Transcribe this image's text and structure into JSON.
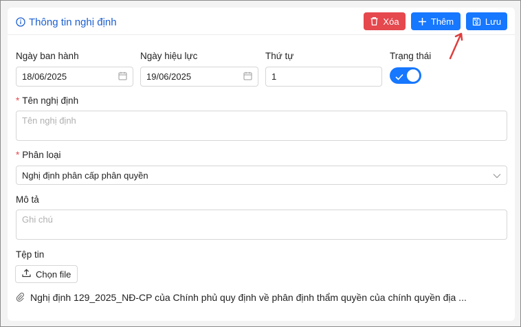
{
  "header": {
    "title": "Thông tin nghị định",
    "delete_label": "Xóa",
    "add_label": "Thêm",
    "save_label": "Lưu"
  },
  "form": {
    "issue_date": {
      "label": "Ngày ban hành",
      "value": "18/06/2025"
    },
    "effective_date": {
      "label": "Ngày hiệu lực",
      "value": "19/06/2025"
    },
    "order": {
      "label": "Thứ tự",
      "value": "1"
    },
    "status": {
      "label": "Trạng thái",
      "enabled": true
    },
    "name": {
      "label": "Tên nghị định",
      "required_mark": "*",
      "placeholder": "Tên nghị định",
      "value": ""
    },
    "category": {
      "label": "Phân loại",
      "required_mark": "*",
      "value": "Nghị định phân cấp phân quyền"
    },
    "description": {
      "label": "Mô tả",
      "placeholder": "Ghi chú",
      "value": ""
    },
    "file": {
      "label": "Tệp tin",
      "button_label": "Chọn file",
      "attached_name": "Nghị định 129_2025_NĐ-CP của Chính phủ quy định về phân định thẩm quyền của chính quyền địa ..."
    }
  },
  "colors": {
    "primary": "#1677ff",
    "danger": "#e5484d",
    "title": "#1a5fd0",
    "annotation_arrow": "#e03c3c"
  },
  "icons": {
    "title": "info-circle-icon",
    "delete": "trash-icon",
    "add": "plus-icon",
    "save": "floppy-disk-icon",
    "date": "calendar-icon",
    "select": "chevron-down-icon",
    "upload": "upload-icon",
    "attachment": "paperclip-icon"
  }
}
